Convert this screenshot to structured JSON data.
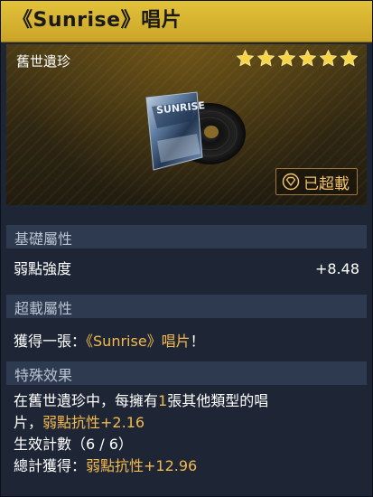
{
  "title": "《Sunrise》唱片",
  "rarity_label": "舊世遺珍",
  "stars": 6,
  "star_color": "#f7d445",
  "overload_label": "已超載",
  "base_attributes": {
    "header": "基礎屬性",
    "stat_name": "弱點強度",
    "stat_value": "+8.48"
  },
  "overload_attributes": {
    "header": "超載屬性",
    "prefix": "獲得一張：",
    "item": "《Sunrise》唱片",
    "suffix": "！"
  },
  "special_effect": {
    "header": "特殊效果",
    "line1_a": "在舊世遺珍中，每擁有",
    "line1_num": "1",
    "line1_b": "張其他類型的唱",
    "line2_a": "片，",
    "line2_bonus": "弱點抗性+2.16",
    "stack_label": "生效計數（6 / 6）",
    "total_prefix": "總計獲得：",
    "total_value": "弱點抗性+12.96"
  },
  "colors": {
    "title_bar": "#d9b634",
    "highlight": "#f3b94e",
    "panel": "#1e2636",
    "section": "#2e3a4f"
  }
}
